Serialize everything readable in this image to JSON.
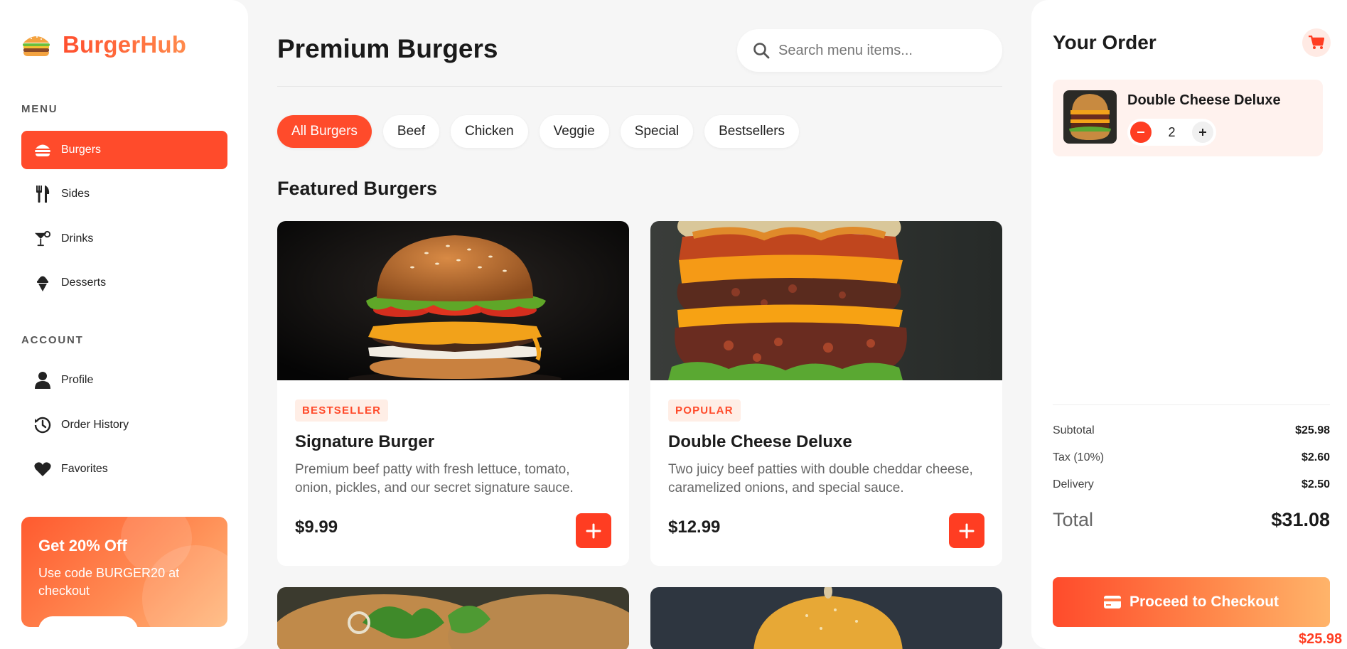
{
  "brand": {
    "name": "BurgerHub"
  },
  "sidebar": {
    "menu_title": "MENU",
    "menu_items": [
      {
        "label": "Burgers",
        "icon": "burger-icon",
        "active": true
      },
      {
        "label": "Sides",
        "icon": "utensils-icon"
      },
      {
        "label": "Drinks",
        "icon": "cocktail-icon"
      },
      {
        "label": "Desserts",
        "icon": "ice-cream-icon"
      }
    ],
    "account_title": "ACCOUNT",
    "account_items": [
      {
        "label": "Profile",
        "icon": "user-icon"
      },
      {
        "label": "Order History",
        "icon": "history-icon"
      },
      {
        "label": "Favorites",
        "icon": "heart-icon"
      }
    ],
    "promo": {
      "title": "Get 20% Off",
      "text": "Use code BURGER20 at checkout"
    }
  },
  "main": {
    "title": "Premium Burgers",
    "search_placeholder": "Search menu items...",
    "filters": [
      "All Burgers",
      "Beef",
      "Chicken",
      "Veggie",
      "Special",
      "Bestsellers"
    ],
    "active_filter": "All Burgers",
    "section_title": "Featured Burgers",
    "products": [
      {
        "badge": "BESTSELLER",
        "name": "Signature Burger",
        "description": "Premium beef patty with fresh lettuce, tomato, onion, pickles, and our secret signature sauce.",
        "price": "$9.99"
      },
      {
        "badge": "POPULAR",
        "name": "Double Cheese Deluxe",
        "description": "Two juicy beef patties with double cheddar cheese, caramelized onions, and special sauce.",
        "price": "$12.99"
      }
    ]
  },
  "order": {
    "title": "Your Order",
    "items": [
      {
        "name": "Double Cheese Deluxe",
        "qty": "2"
      }
    ],
    "subtotal_label": "Subtotal",
    "subtotal": "$25.98",
    "tax_label": "Tax (10%)",
    "tax": "$2.60",
    "delivery_label": "Delivery",
    "delivery": "$2.50",
    "total_label": "Total",
    "total": "$31.08",
    "checkout_label": "Proceed to Checkout",
    "item_price": "$25.98"
  },
  "colors": {
    "accent": "#ff4b2b",
    "accent_light": "#ffeee6",
    "background": "#f6f6f6"
  }
}
